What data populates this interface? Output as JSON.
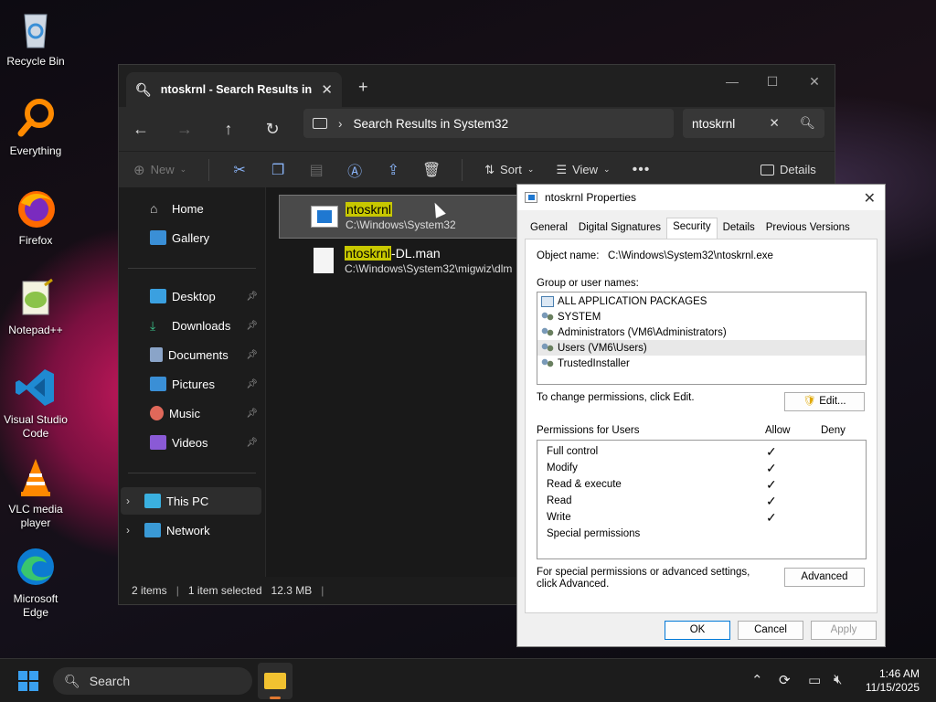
{
  "desktop": {
    "icons": [
      {
        "label": "Recycle Bin",
        "icon": "recycle-bin-icon"
      },
      {
        "label": "Everything",
        "icon": "everything-search-icon"
      },
      {
        "label": "Firefox",
        "icon": "firefox-icon"
      },
      {
        "label": "Notepad++",
        "icon": "notepad-plus-plus-icon"
      },
      {
        "label": "Visual Studio Code",
        "icon": "vscode-icon"
      },
      {
        "label": "VLC media player",
        "icon": "vlc-icon"
      },
      {
        "label": "Microsoft Edge",
        "icon": "edge-icon"
      }
    ]
  },
  "explorer": {
    "tab_title": "ntoskrnl - Search Results in Sy",
    "new_tab": "+",
    "breadcrumb": "Search Results in System32",
    "search_value": "ntoskrnl",
    "toolbar": {
      "new": "New",
      "sort": "Sort",
      "view": "View",
      "details": "Details"
    },
    "sidebar": {
      "home": "Home",
      "gallery": "Gallery",
      "desktop": "Desktop",
      "downloads": "Downloads",
      "documents": "Documents",
      "pictures": "Pictures",
      "music": "Music",
      "videos": "Videos",
      "this_pc": "This PC",
      "network": "Network"
    },
    "results": [
      {
        "highlight": "ntoskrnl",
        "rest": "",
        "path": "C:\\Windows\\System32"
      },
      {
        "highlight": "ntoskrnl",
        "rest": "-DL.man",
        "path": "C:\\Windows\\System32\\migwiz\\dlm"
      }
    ],
    "status": {
      "count": "2 items",
      "selected": "1 item selected",
      "size": "12.3 MB"
    }
  },
  "dialog": {
    "title": "ntoskrnl Properties",
    "tabs": [
      "General",
      "Digital Signatures",
      "Security",
      "Details",
      "Previous Versions"
    ],
    "object_label": "Object name:",
    "object_value": "C:\\Windows\\System32\\ntoskrnl.exe",
    "groups_label": "Group or user names:",
    "groups": [
      "ALL APPLICATION PACKAGES",
      "SYSTEM",
      "Administrators (VM6\\Administrators)",
      "Users (VM6\\Users)",
      "TrustedInstaller"
    ],
    "change_text": "To change permissions, click Edit.",
    "edit_button": "Edit...",
    "perm_label": "Permissions for Users",
    "allow": "Allow",
    "deny": "Deny",
    "permissions": [
      {
        "name": "Full control",
        "allow": true
      },
      {
        "name": "Modify",
        "allow": true
      },
      {
        "name": "Read & execute",
        "allow": true
      },
      {
        "name": "Read",
        "allow": true
      },
      {
        "name": "Write",
        "allow": true
      },
      {
        "name": "Special permissions",
        "allow": false
      }
    ],
    "advanced_text": "For special permissions or advanced settings, click Advanced.",
    "advanced_button": "Advanced",
    "ok": "OK",
    "cancel": "Cancel",
    "apply": "Apply"
  },
  "taskbar": {
    "search_placeholder": "Search",
    "time": "1:46 AM",
    "date": "11/15/2025"
  }
}
